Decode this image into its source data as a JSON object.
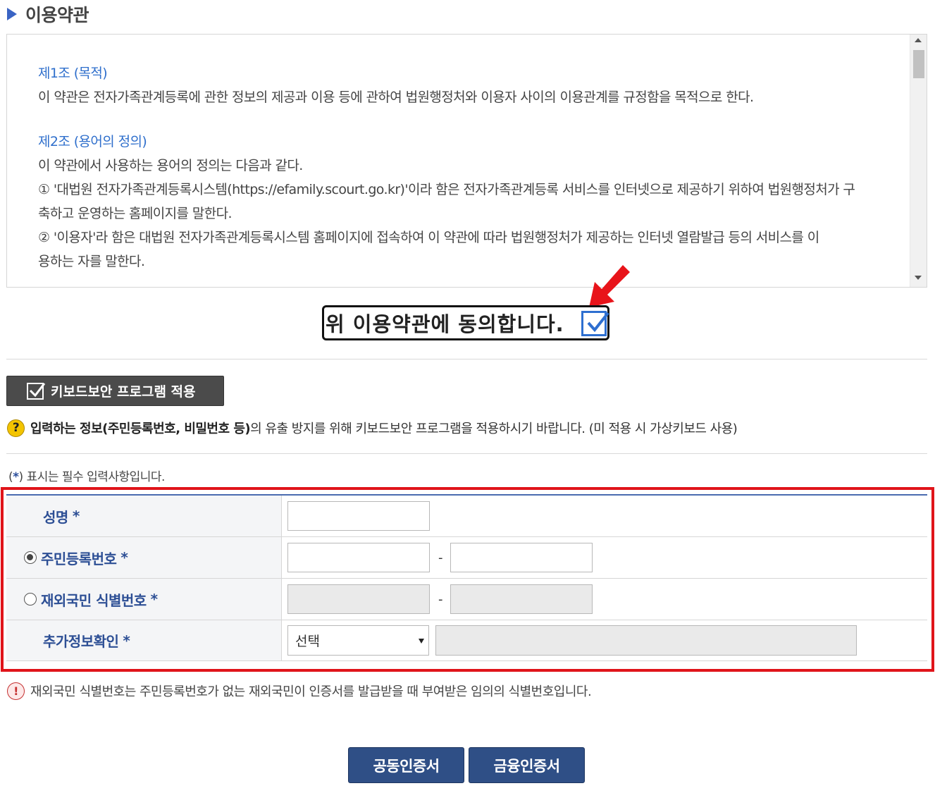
{
  "section_title": "이용약관",
  "terms": {
    "article1_title": "제1조 (목적)",
    "article1_body": "이 약관은 전자가족관계등록에 관한 정보의 제공과 이용 등에 관하여 법원행정처와 이용자 사이의 이용관계를 규정함을 목적으로 한다.",
    "article2_title": "제2조 (용어의 정의)",
    "article2_intro": "이 약관에서 사용하는 용어의 정의는 다음과 같다.",
    "article2_item1_line1": "① '대법원 전자가족관계등록시스템(https://efamily.scourt.go.kr)'이라 함은 전자가족관계등록 서비스를 인터넷으로 제공하기 위하여 법원행정처가 구",
    "article2_item1_line2": "축하고 운영하는 홈페이지를 말한다.",
    "article2_item2_line1": "② '이용자'라 함은 대법원 전자가족관계등록시스템 홈페이지에 접속하여 이 약관에 따라 법원행정처가 제공하는 인터넷 열람발급 등의 서비스를 이",
    "article2_item2_line2": "용하는 자를 말한다."
  },
  "agree": {
    "label": "위 이용약관에 동의합니다.",
    "checked": true
  },
  "keyboard_security": {
    "button_label": "키보드보안 프로그램 적용",
    "notice_icon": "?",
    "notice_bold": "입력하는 정보(주민등록번호, 비밀번호 등)",
    "notice_rest": "의 유출 방지를 위해 키보드보안 프로그램을 적용하시기 바랍니다. (미 적용 시 가상키보드 사용)"
  },
  "required_note": {
    "open": "(",
    "star": "*",
    "rest": ") 표시는 필수 입력사항입니다."
  },
  "form": {
    "name_label": "성명",
    "rrn_label": "주민등록번호",
    "overseas_label": "재외국민 식별번호",
    "extra_label": "추가정보확인",
    "required_mark": "*",
    "dash": "-",
    "select_value": "선택",
    "rrn_selected": true
  },
  "overseas_notice": {
    "icon": "!",
    "text": "재외국민 식별번호는 주민등록번호가 없는 재외국민이 인증서를 발급받을 때 부여받은 임의의 식별번호입니다."
  },
  "buttons": {
    "joint_cert": "공동인증서",
    "financial_cert": "금융인증서"
  },
  "colors": {
    "accent_blue": "#2d4f95",
    "link_blue": "#2f6fcc",
    "highlight_red": "#e0141a",
    "button_navy": "#2f4f86"
  }
}
